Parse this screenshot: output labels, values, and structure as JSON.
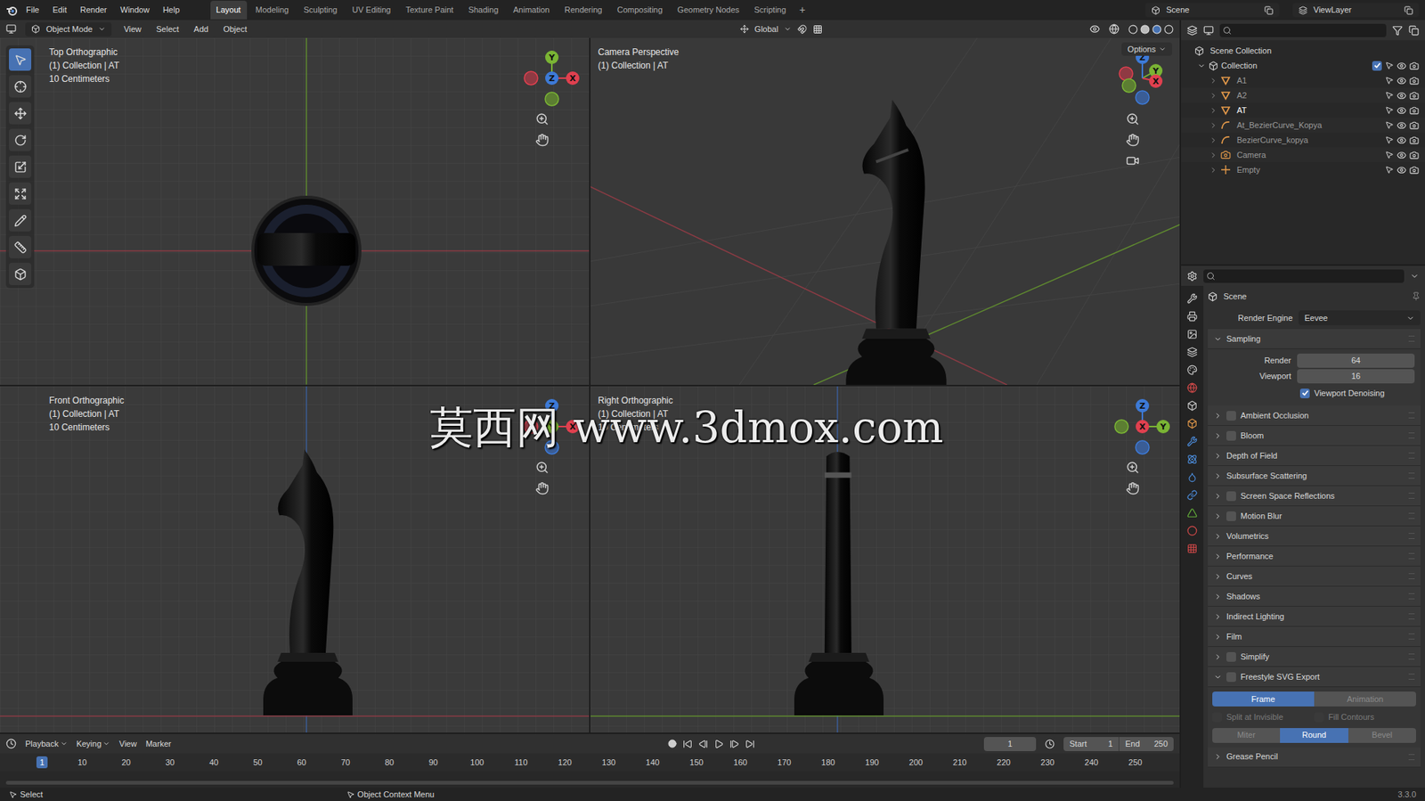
{
  "menu": [
    "File",
    "Edit",
    "Render",
    "Window",
    "Help"
  ],
  "workspaces": [
    {
      "label": "Layout",
      "selected": true
    },
    {
      "label": "Modeling",
      "selected": false
    },
    {
      "label": "Sculpting",
      "selected": false
    },
    {
      "label": "UV Editing",
      "selected": false
    },
    {
      "label": "Texture Paint",
      "selected": false
    },
    {
      "label": "Shading",
      "selected": false
    },
    {
      "label": "Animation",
      "selected": false
    },
    {
      "label": "Rendering",
      "selected": false
    },
    {
      "label": "Compositing",
      "selected": false
    },
    {
      "label": "Geometry Nodes",
      "selected": false
    },
    {
      "label": "Scripting",
      "selected": false
    }
  ],
  "add_workspace": "+",
  "scene": "Scene",
  "view_layer": "ViewLayer",
  "viewport_header": {
    "mode": "Object Mode",
    "menus": [
      "View",
      "Select",
      "Add",
      "Object"
    ],
    "orientation": "Global",
    "options": "Options"
  },
  "viewports": [
    {
      "name": "top",
      "title": "Top Orthographic",
      "lines": [
        "(1) Collection | AT",
        "10 Centimeters"
      ]
    },
    {
      "name": "camera",
      "title": "Camera Perspective",
      "lines": [
        "(1) Collection | AT"
      ]
    },
    {
      "name": "front",
      "title": "Front Orthographic",
      "lines": [
        "(1) Collection | AT",
        "10 Centimeters"
      ]
    },
    {
      "name": "right",
      "title": "Right Orthographic",
      "lines": [
        "(1) Collection | AT",
        "10 Centimeters"
      ]
    }
  ],
  "gizmo_axes": [
    "X",
    "Y",
    "Z"
  ],
  "watermark": "莫西网 www.3dmox.com",
  "outliner": {
    "root": "Scene Collection",
    "collection": {
      "label": "Collection",
      "checked": true
    },
    "items": [
      {
        "label": "A1",
        "kind": "mesh",
        "selected": false
      },
      {
        "label": "A2",
        "kind": "mesh",
        "selected": false
      },
      {
        "label": "AT",
        "kind": "mesh",
        "selected": true
      },
      {
        "label": "At_BezierCurve_Kopya",
        "kind": "curve",
        "selected": false
      },
      {
        "label": "BezierCurve_kopya",
        "kind": "curve",
        "selected": false
      },
      {
        "label": "Camera",
        "kind": "camera",
        "selected": false
      },
      {
        "label": "Empty",
        "kind": "empty",
        "selected": false
      }
    ]
  },
  "properties": {
    "title": "Scene",
    "render_engine_label": "Render Engine",
    "render_engine": "Eevee",
    "sampling": {
      "label": "Sampling",
      "expanded": true,
      "fields": [
        {
          "label": "Render",
          "value": "64"
        },
        {
          "label": "Viewport",
          "value": "16"
        }
      ],
      "denoise": {
        "label": "Viewport Denoising",
        "checked": true
      }
    },
    "panels": [
      {
        "label": "Ambient Occlusion",
        "kind": "toggle",
        "checked": false
      },
      {
        "label": "Bloom",
        "kind": "toggle",
        "checked": false
      },
      {
        "label": "Depth of Field",
        "kind": "plain",
        "checked": false
      },
      {
        "label": "Subsurface Scattering",
        "kind": "plain",
        "checked": false
      },
      {
        "label": "Screen Space Reflections",
        "kind": "toggle",
        "checked": false
      },
      {
        "label": "Motion Blur",
        "kind": "toggle",
        "checked": false
      },
      {
        "label": "Volumetrics",
        "kind": "plain",
        "checked": false
      },
      {
        "label": "Performance",
        "kind": "plain",
        "checked": false
      },
      {
        "label": "Curves",
        "kind": "plain",
        "checked": false
      },
      {
        "label": "Shadows",
        "kind": "plain",
        "checked": false
      },
      {
        "label": "Indirect Lighting",
        "kind": "plain",
        "checked": false
      },
      {
        "label": "Film",
        "kind": "plain",
        "checked": false
      },
      {
        "label": "Simplify",
        "kind": "toggle",
        "checked": false
      }
    ],
    "freestyle": {
      "label": "Freestyle SVG Export",
      "checked": false,
      "expanded": true,
      "modes": [
        {
          "label": "Frame",
          "selected": true
        },
        {
          "label": "Animation",
          "selected": false
        }
      ],
      "options": [
        {
          "label": "Split at Invisible",
          "checked": false,
          "disabled": true
        },
        {
          "label": "Fill Contours",
          "checked": false,
          "disabled": true
        }
      ],
      "joins": [
        {
          "label": "Miter",
          "selected": false
        },
        {
          "label": "Round",
          "selected": true
        },
        {
          "label": "Bevel",
          "selected": false
        }
      ]
    },
    "last_panel": "Grease Pencil"
  },
  "timeline": {
    "menus": [
      "Playback",
      "Keying",
      "View",
      "Marker"
    ],
    "current_frame": "1",
    "start_label": "Start",
    "start": "1",
    "end_label": "End",
    "end": "250",
    "ticks": [
      "1",
      "10",
      "20",
      "30",
      "40",
      "50",
      "60",
      "70",
      "80",
      "90",
      "100",
      "110",
      "120",
      "130",
      "140",
      "150",
      "160",
      "170",
      "180",
      "190",
      "200",
      "210",
      "220",
      "230",
      "240",
      "250"
    ],
    "selected_tick": "1"
  },
  "status_bar": {
    "items": [
      "Select",
      "Object Context Menu"
    ],
    "version": "3.3.0"
  }
}
